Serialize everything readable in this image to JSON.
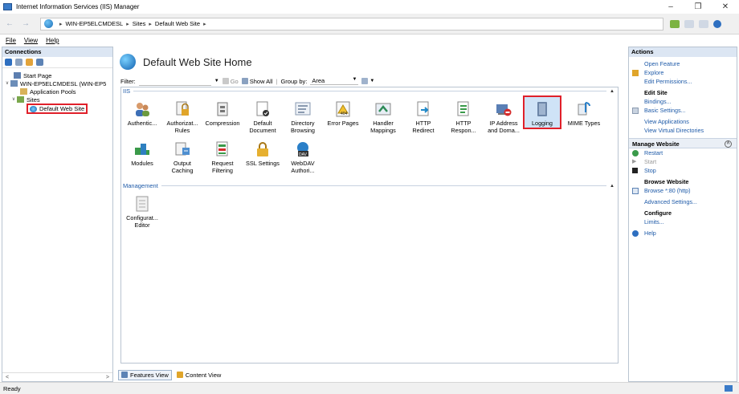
{
  "window": {
    "title": "Internet Information Services (IIS) Manager",
    "controls": [
      "–",
      "❐",
      "✕"
    ]
  },
  "address": {
    "crumbs": [
      "WIN-EP5ELCMDESL",
      "Sites",
      "Default Web Site"
    ]
  },
  "menu": [
    "File",
    "View",
    "Help"
  ],
  "connections": {
    "title": "Connections",
    "tree": [
      {
        "label": "Start Page",
        "level": 0
      },
      {
        "label": "WIN-EP5ELCMDESL (WIN-EP5",
        "level": 0
      },
      {
        "label": "Application Pools",
        "level": 1
      },
      {
        "label": "Sites",
        "level": 1
      },
      {
        "label": "Default Web Site",
        "level": 2,
        "selected": true
      }
    ]
  },
  "center": {
    "title": "Default Web Site Home",
    "filter": {
      "label": "Filter:",
      "go": "Go",
      "show_all": "Show All",
      "group_by_label": "Group by:",
      "group_by_value": "Area"
    },
    "groups": [
      {
        "name": "IIS"
      },
      {
        "name": "Management"
      }
    ],
    "features_iis": [
      {
        "label": "Authentic...",
        "icon": "users-icon"
      },
      {
        "label": "Authorizat... Rules",
        "icon": "lock-doc-icon"
      },
      {
        "label": "Compression",
        "icon": "compress-icon"
      },
      {
        "label": "Default Document",
        "icon": "document-icon"
      },
      {
        "label": "Directory Browsing",
        "icon": "folder-browse-icon"
      },
      {
        "label": "Error Pages",
        "icon": "warning-icon"
      },
      {
        "label": "Handler Mappings",
        "icon": "handler-icon"
      },
      {
        "label": "HTTP Redirect",
        "icon": "redirect-icon"
      },
      {
        "label": "HTTP Respon...",
        "icon": "response-icon"
      },
      {
        "label": "IP Address and Doma...",
        "icon": "ip-icon"
      },
      {
        "label": "Logging",
        "icon": "logging-icon",
        "highlighted": true
      },
      {
        "label": "MIME Types",
        "icon": "mime-icon"
      },
      {
        "label": "Modules",
        "icon": "modules-icon"
      },
      {
        "label": "Output Caching",
        "icon": "cache-icon"
      },
      {
        "label": "Request Filtering",
        "icon": "filter-icon"
      },
      {
        "label": "SSL Settings",
        "icon": "padlock-icon"
      },
      {
        "label": "WebDAV Authori...",
        "icon": "webdav-icon"
      }
    ],
    "features_mgmt": [
      {
        "label": "Configurat... Editor",
        "icon": "config-editor-icon"
      }
    ],
    "tabs": {
      "features": "Features View",
      "content": "Content View"
    }
  },
  "actions": {
    "title": "Actions",
    "items": [
      {
        "label": "Open Feature",
        "type": "link"
      },
      {
        "label": "Explore",
        "type": "link",
        "icon": "explore-icon"
      },
      {
        "label": "Edit Permissions...",
        "type": "link"
      },
      {
        "label": "Edit Site",
        "type": "head"
      },
      {
        "label": "Bindings...",
        "type": "link"
      },
      {
        "label": "Basic Settings...",
        "type": "link",
        "icon": "settings-icon"
      },
      {
        "label": "View Applications",
        "type": "link"
      },
      {
        "label": "View Virtual Directories",
        "type": "link"
      }
    ],
    "manage": {
      "title": "Manage Website",
      "items": [
        {
          "label": "Restart",
          "type": "link",
          "icon": "restart-icon"
        },
        {
          "label": "Start",
          "type": "disabled",
          "icon": "play-icon"
        },
        {
          "label": "Stop",
          "type": "link",
          "icon": "stop-icon"
        },
        {
          "label": "Browse Website",
          "type": "head"
        },
        {
          "label": "Browse *:80 (http)",
          "type": "link",
          "icon": "browse-icon"
        },
        {
          "label": "Advanced Settings...",
          "type": "link"
        },
        {
          "label": "Configure",
          "type": "head"
        },
        {
          "label": "Limits...",
          "type": "link"
        },
        {
          "label": "Help",
          "type": "link",
          "icon": "help-icon"
        }
      ]
    }
  },
  "status": {
    "text": "Ready"
  },
  "colors": {
    "link": "#1e5aa8",
    "highlight": "#e0202a",
    "pane_header": "#dce6f3"
  }
}
